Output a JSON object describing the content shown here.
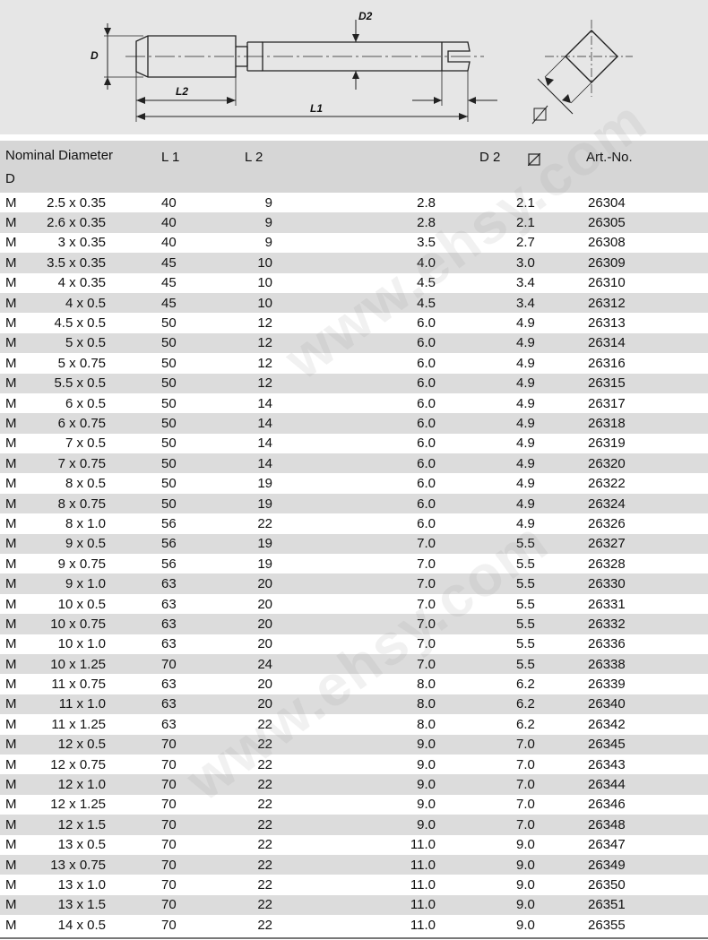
{
  "diagram": {
    "labels": {
      "d": "D",
      "d2": "D2",
      "l1": "L1",
      "l2": "L2"
    }
  },
  "watermark": "www.ehsy.com",
  "table": {
    "headers": {
      "nominal_line1": "Nominal Diameter",
      "nominal_line2": "D",
      "l1": "L 1",
      "l2": "L 2",
      "d2": "D 2",
      "square_icon": "square-symbol-icon",
      "art": "Art.-No."
    },
    "rows": [
      {
        "m": "M",
        "size": "2.5 x 0.35",
        "l1": "40",
        "l2": "9",
        "d2": "2.8",
        "sq": "2.1",
        "art": "26304"
      },
      {
        "m": "M",
        "size": "2.6 x 0.35",
        "l1": "40",
        "l2": "9",
        "d2": "2.8",
        "sq": "2.1",
        "art": "26305"
      },
      {
        "m": "M",
        "size": "3 x 0.35",
        "l1": "40",
        "l2": "9",
        "d2": "3.5",
        "sq": "2.7",
        "art": "26308"
      },
      {
        "m": "M",
        "size": "3.5 x 0.35",
        "l1": "45",
        "l2": "10",
        "d2": "4.0",
        "sq": "3.0",
        "art": "26309"
      },
      {
        "m": "M",
        "size": "4 x 0.35",
        "l1": "45",
        "l2": "10",
        "d2": "4.5",
        "sq": "3.4",
        "art": "26310"
      },
      {
        "m": "M",
        "size": "4 x 0.5",
        "l1": "45",
        "l2": "10",
        "d2": "4.5",
        "sq": "3.4",
        "art": "26312"
      },
      {
        "m": "M",
        "size": "4.5 x 0.5",
        "l1": "50",
        "l2": "12",
        "d2": "6.0",
        "sq": "4.9",
        "art": "26313"
      },
      {
        "m": "M",
        "size": "5 x 0.5",
        "l1": "50",
        "l2": "12",
        "d2": "6.0",
        "sq": "4.9",
        "art": "26314"
      },
      {
        "m": "M",
        "size": "5 x 0.75",
        "l1": "50",
        "l2": "12",
        "d2": "6.0",
        "sq": "4.9",
        "art": "26316"
      },
      {
        "m": "M",
        "size": "5.5 x 0.5",
        "l1": "50",
        "l2": "12",
        "d2": "6.0",
        "sq": "4.9",
        "art": "26315"
      },
      {
        "m": "M",
        "size": "6 x 0.5",
        "l1": "50",
        "l2": "14",
        "d2": "6.0",
        "sq": "4.9",
        "art": "26317"
      },
      {
        "m": "M",
        "size": "6 x 0.75",
        "l1": "50",
        "l2": "14",
        "d2": "6.0",
        "sq": "4.9",
        "art": "26318"
      },
      {
        "m": "M",
        "size": "7 x 0.5",
        "l1": "50",
        "l2": "14",
        "d2": "6.0",
        "sq": "4.9",
        "art": "26319"
      },
      {
        "m": "M",
        "size": "7 x 0.75",
        "l1": "50",
        "l2": "14",
        "d2": "6.0",
        "sq": "4.9",
        "art": "26320"
      },
      {
        "m": "M",
        "size": "8 x 0.5",
        "l1": "50",
        "l2": "19",
        "d2": "6.0",
        "sq": "4.9",
        "art": "26322"
      },
      {
        "m": "M",
        "size": "8 x 0.75",
        "l1": "50",
        "l2": "19",
        "d2": "6.0",
        "sq": "4.9",
        "art": "26324"
      },
      {
        "m": "M",
        "size": "8 x 1.0",
        "l1": "56",
        "l2": "22",
        "d2": "6.0",
        "sq": "4.9",
        "art": "26326"
      },
      {
        "m": "M",
        "size": "9 x 0.5",
        "l1": "56",
        "l2": "19",
        "d2": "7.0",
        "sq": "5.5",
        "art": "26327"
      },
      {
        "m": "M",
        "size": "9 x 0.75",
        "l1": "56",
        "l2": "19",
        "d2": "7.0",
        "sq": "5.5",
        "art": "26328"
      },
      {
        "m": "M",
        "size": "9 x 1.0",
        "l1": "63",
        "l2": "20",
        "d2": "7.0",
        "sq": "5.5",
        "art": "26330"
      },
      {
        "m": "M",
        "size": "10 x 0.5",
        "l1": "63",
        "l2": "20",
        "d2": "7.0",
        "sq": "5.5",
        "art": "26331"
      },
      {
        "m": "M",
        "size": "10 x 0.75",
        "l1": "63",
        "l2": "20",
        "d2": "7.0",
        "sq": "5.5",
        "art": "26332"
      },
      {
        "m": "M",
        "size": "10 x 1.0",
        "l1": "63",
        "l2": "20",
        "d2": "7.0",
        "sq": "5.5",
        "art": "26336"
      },
      {
        "m": "M",
        "size": "10 x 1.25",
        "l1": "70",
        "l2": "24",
        "d2": "7.0",
        "sq": "5.5",
        "art": "26338"
      },
      {
        "m": "M",
        "size": "11 x 0.75",
        "l1": "63",
        "l2": "20",
        "d2": "8.0",
        "sq": "6.2",
        "art": "26339"
      },
      {
        "m": "M",
        "size": "11 x 1.0",
        "l1": "63",
        "l2": "20",
        "d2": "8.0",
        "sq": "6.2",
        "art": "26340"
      },
      {
        "m": "M",
        "size": "11 x 1.25",
        "l1": "63",
        "l2": "22",
        "d2": "8.0",
        "sq": "6.2",
        "art": "26342"
      },
      {
        "m": "M",
        "size": "12 x 0.5",
        "l1": "70",
        "l2": "22",
        "d2": "9.0",
        "sq": "7.0",
        "art": "26345"
      },
      {
        "m": "M",
        "size": "12 x 0.75",
        "l1": "70",
        "l2": "22",
        "d2": "9.0",
        "sq": "7.0",
        "art": "26343"
      },
      {
        "m": "M",
        "size": "12 x 1.0",
        "l1": "70",
        "l2": "22",
        "d2": "9.0",
        "sq": "7.0",
        "art": "26344"
      },
      {
        "m": "M",
        "size": "12 x 1.25",
        "l1": "70",
        "l2": "22",
        "d2": "9.0",
        "sq": "7.0",
        "art": "26346"
      },
      {
        "m": "M",
        "size": "12 x 1.5",
        "l1": "70",
        "l2": "22",
        "d2": "9.0",
        "sq": "7.0",
        "art": "26348"
      },
      {
        "m": "M",
        "size": "13 x 0.5",
        "l1": "70",
        "l2": "22",
        "d2": "11.0",
        "sq": "9.0",
        "art": "26347"
      },
      {
        "m": "M",
        "size": "13 x 0.75",
        "l1": "70",
        "l2": "22",
        "d2": "11.0",
        "sq": "9.0",
        "art": "26349"
      },
      {
        "m": "M",
        "size": "13 x 1.0",
        "l1": "70",
        "l2": "22",
        "d2": "11.0",
        "sq": "9.0",
        "art": "26350"
      },
      {
        "m": "M",
        "size": "13 x 1.5",
        "l1": "70",
        "l2": "22",
        "d2": "11.0",
        "sq": "9.0",
        "art": "26351"
      },
      {
        "m": "M",
        "size": "14 x 0.5",
        "l1": "70",
        "l2": "22",
        "d2": "11.0",
        "sq": "9.0",
        "art": "26355"
      }
    ]
  }
}
